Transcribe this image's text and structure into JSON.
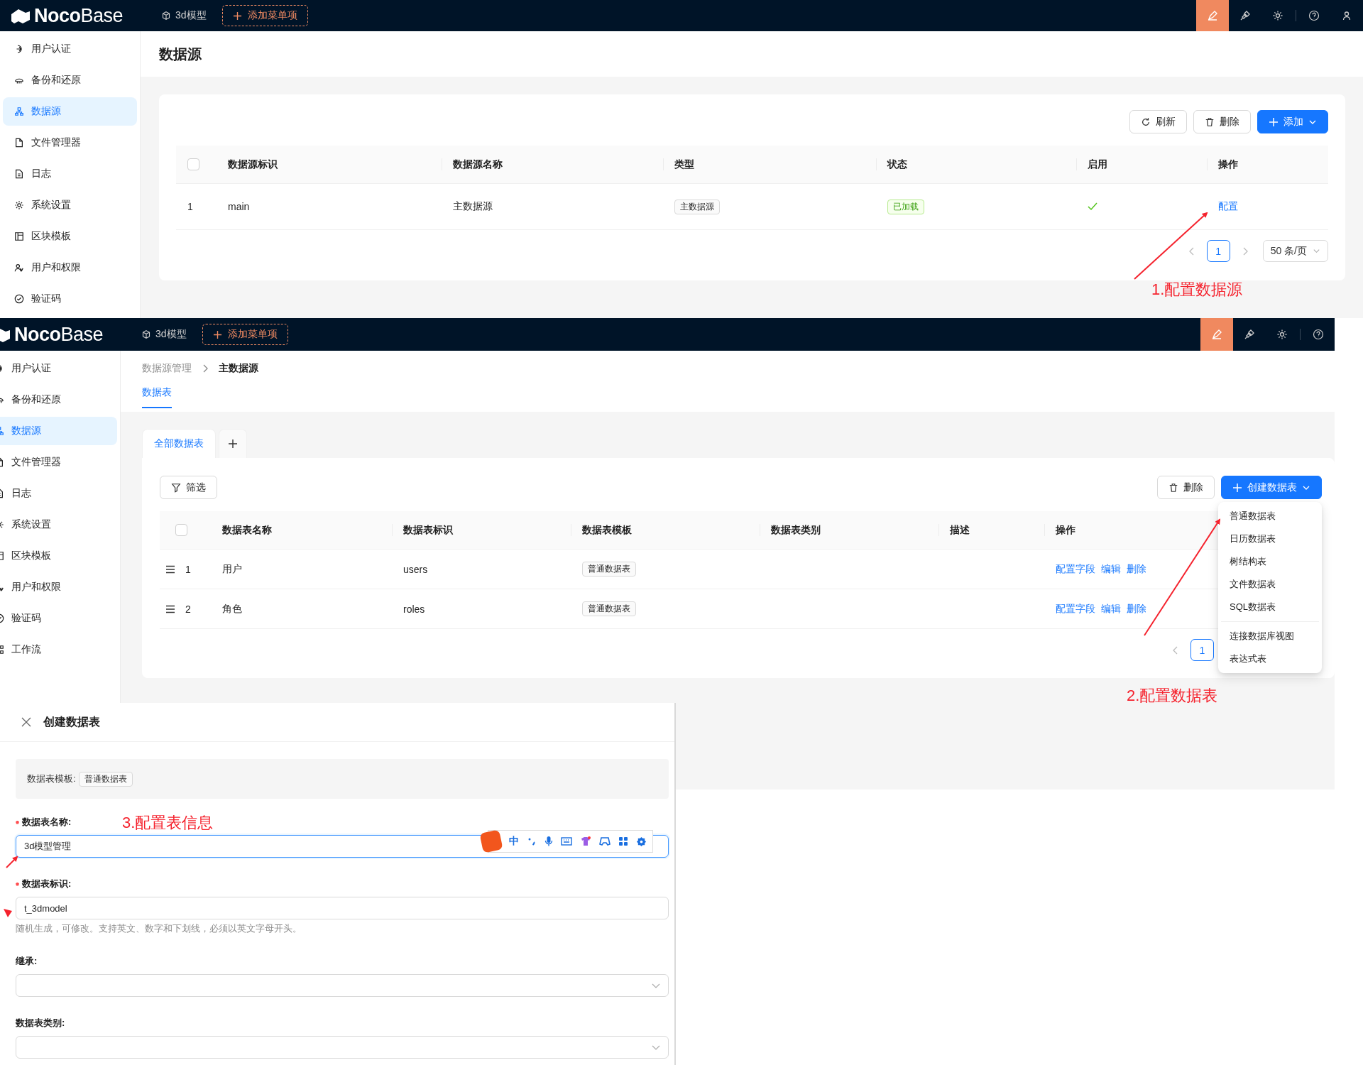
{
  "screen_1": {
    "top_bar": {
      "logo": "**Noco**Base",
      "menu_item": "3d模型",
      "add_button": "添加菜单项",
      "ui_editor_on": true,
      "show_user": true
    },
    "sidebar": {
      "items": [
        {
          "label": "用户认证",
          "selected": false
        },
        {
          "label": "备份和还原",
          "selected": false
        },
        {
          "label": "数据源",
          "selected": true
        },
        {
          "label": "文件管理器",
          "selected": false
        },
        {
          "label": "日志",
          "selected": false
        },
        {
          "label": "系统设置",
          "selected": false
        },
        {
          "label": "区块模板",
          "selected": false
        },
        {
          "label": "用户和权限",
          "selected": false
        },
        {
          "label": "验证码",
          "selected": false
        }
      ]
    },
    "page_title": "数据源",
    "toolbar": [
      {
        "kind": "refresh",
        "label": "刷新"
      },
      {
        "kind": "delete",
        "label": "删除"
      },
      {
        "kind": "add",
        "label": "添加"
      }
    ],
    "table": {
      "header_checkbox": {
        "checked": false
      },
      "columns": [
        "数据源标识",
        "数据源名称",
        "类型",
        "状态",
        "启用",
        "操作"
      ],
      "rows": [
        {
          "index": "1",
          "key": "main",
          "name": "主数据源",
          "type": "主数据源",
          "status": "已加载",
          "enabled": true,
          "action": "配置"
        }
      ]
    },
    "pagination": {
      "pages": [
        {
          "label": "1",
          "selected": true
        }
      ],
      "page_size": "50 条/页"
    }
  },
  "screen_2": {
    "top_bar": {
      "logo": "**Noco**Base",
      "menu_item": "3d模型",
      "add_button": "添加菜单项",
      "ui_editor_on": true,
      "show_user": false
    },
    "sidebar": {
      "items": [
        {
          "label": "用户认证",
          "selected": false
        },
        {
          "label": "备份和还原",
          "selected": false
        },
        {
          "label": "数据源",
          "selected": true
        },
        {
          "label": "文件管理器",
          "selected": false
        },
        {
          "label": "日志",
          "selected": false
        },
        {
          "label": "系统设置",
          "selected": false
        },
        {
          "label": "区块模板",
          "selected": false
        },
        {
          "label": "用户和权限",
          "selected": false
        },
        {
          "label": "验证码",
          "selected": false
        },
        {
          "label": "工作流",
          "selected": false
        }
      ]
    },
    "breadcrumb": [
      "数据源管理",
      "主数据源"
    ],
    "page_tabs": [
      {
        "label": "数据表",
        "selected": true
      }
    ],
    "collection_tabs": [
      {
        "label": "全部数据表",
        "selected": true
      }
    ],
    "filter_button": "筛选",
    "toolbar": [
      {
        "kind": "delete",
        "label": "删除"
      },
      {
        "kind": "add",
        "label": "创建数据表"
      }
    ],
    "table": {
      "header_checkbox": {
        "checked": false
      },
      "columns": [
        "数据表名称",
        "数据表标识",
        "数据表模板",
        "数据表类别",
        "描述",
        "操作"
      ],
      "rows": [
        {
          "index": "1",
          "name": "用户",
          "key": "users",
          "template": "普通数据表",
          "actions": [
            "配置字段",
            "编辑",
            "删除"
          ]
        },
        {
          "index": "2",
          "name": "角色",
          "key": "roles",
          "template": "普通数据表",
          "actions": [
            "配置字段",
            "编辑",
            "删除"
          ]
        }
      ]
    },
    "pagination": {
      "pages": [
        {
          "label": "1",
          "selected": true
        }
      ]
    },
    "create_menu": {
      "groups": [
        {
          "items": [
            "普通数据表",
            "日历数据表",
            "树结构表",
            "文件数据表",
            "SQL数据表"
          ]
        },
        {
          "items": [
            "连接数据库视图",
            "表达式表"
          ]
        }
      ]
    }
  },
  "screen_3": {
    "drawer_title": "创建数据表",
    "template_label": "数据表模板:",
    "template": "普通数据表",
    "fields": [
      {
        "kind": "input",
        "label": "数据表名称:",
        "required": true,
        "value": "3d模型管理",
        "focused": true
      },
      {
        "kind": "input",
        "label": "数据表标识:",
        "required": true,
        "value": "t_3dmodel",
        "focused": false,
        "help": "随机生成，可修改。支持英文、数字和下划线，必须以英文字母开头。"
      },
      {
        "kind": "select",
        "label": "继承:",
        "required": false
      },
      {
        "kind": "select",
        "label": "数据表类别:",
        "required": false
      }
    ],
    "ime_toolbar": {
      "mode": "中"
    }
  },
  "annotations": [
    {
      "text": "1.配置数据源"
    },
    {
      "text": "2.配置数据表"
    },
    {
      "text": "3.配置表信息"
    }
  ]
}
